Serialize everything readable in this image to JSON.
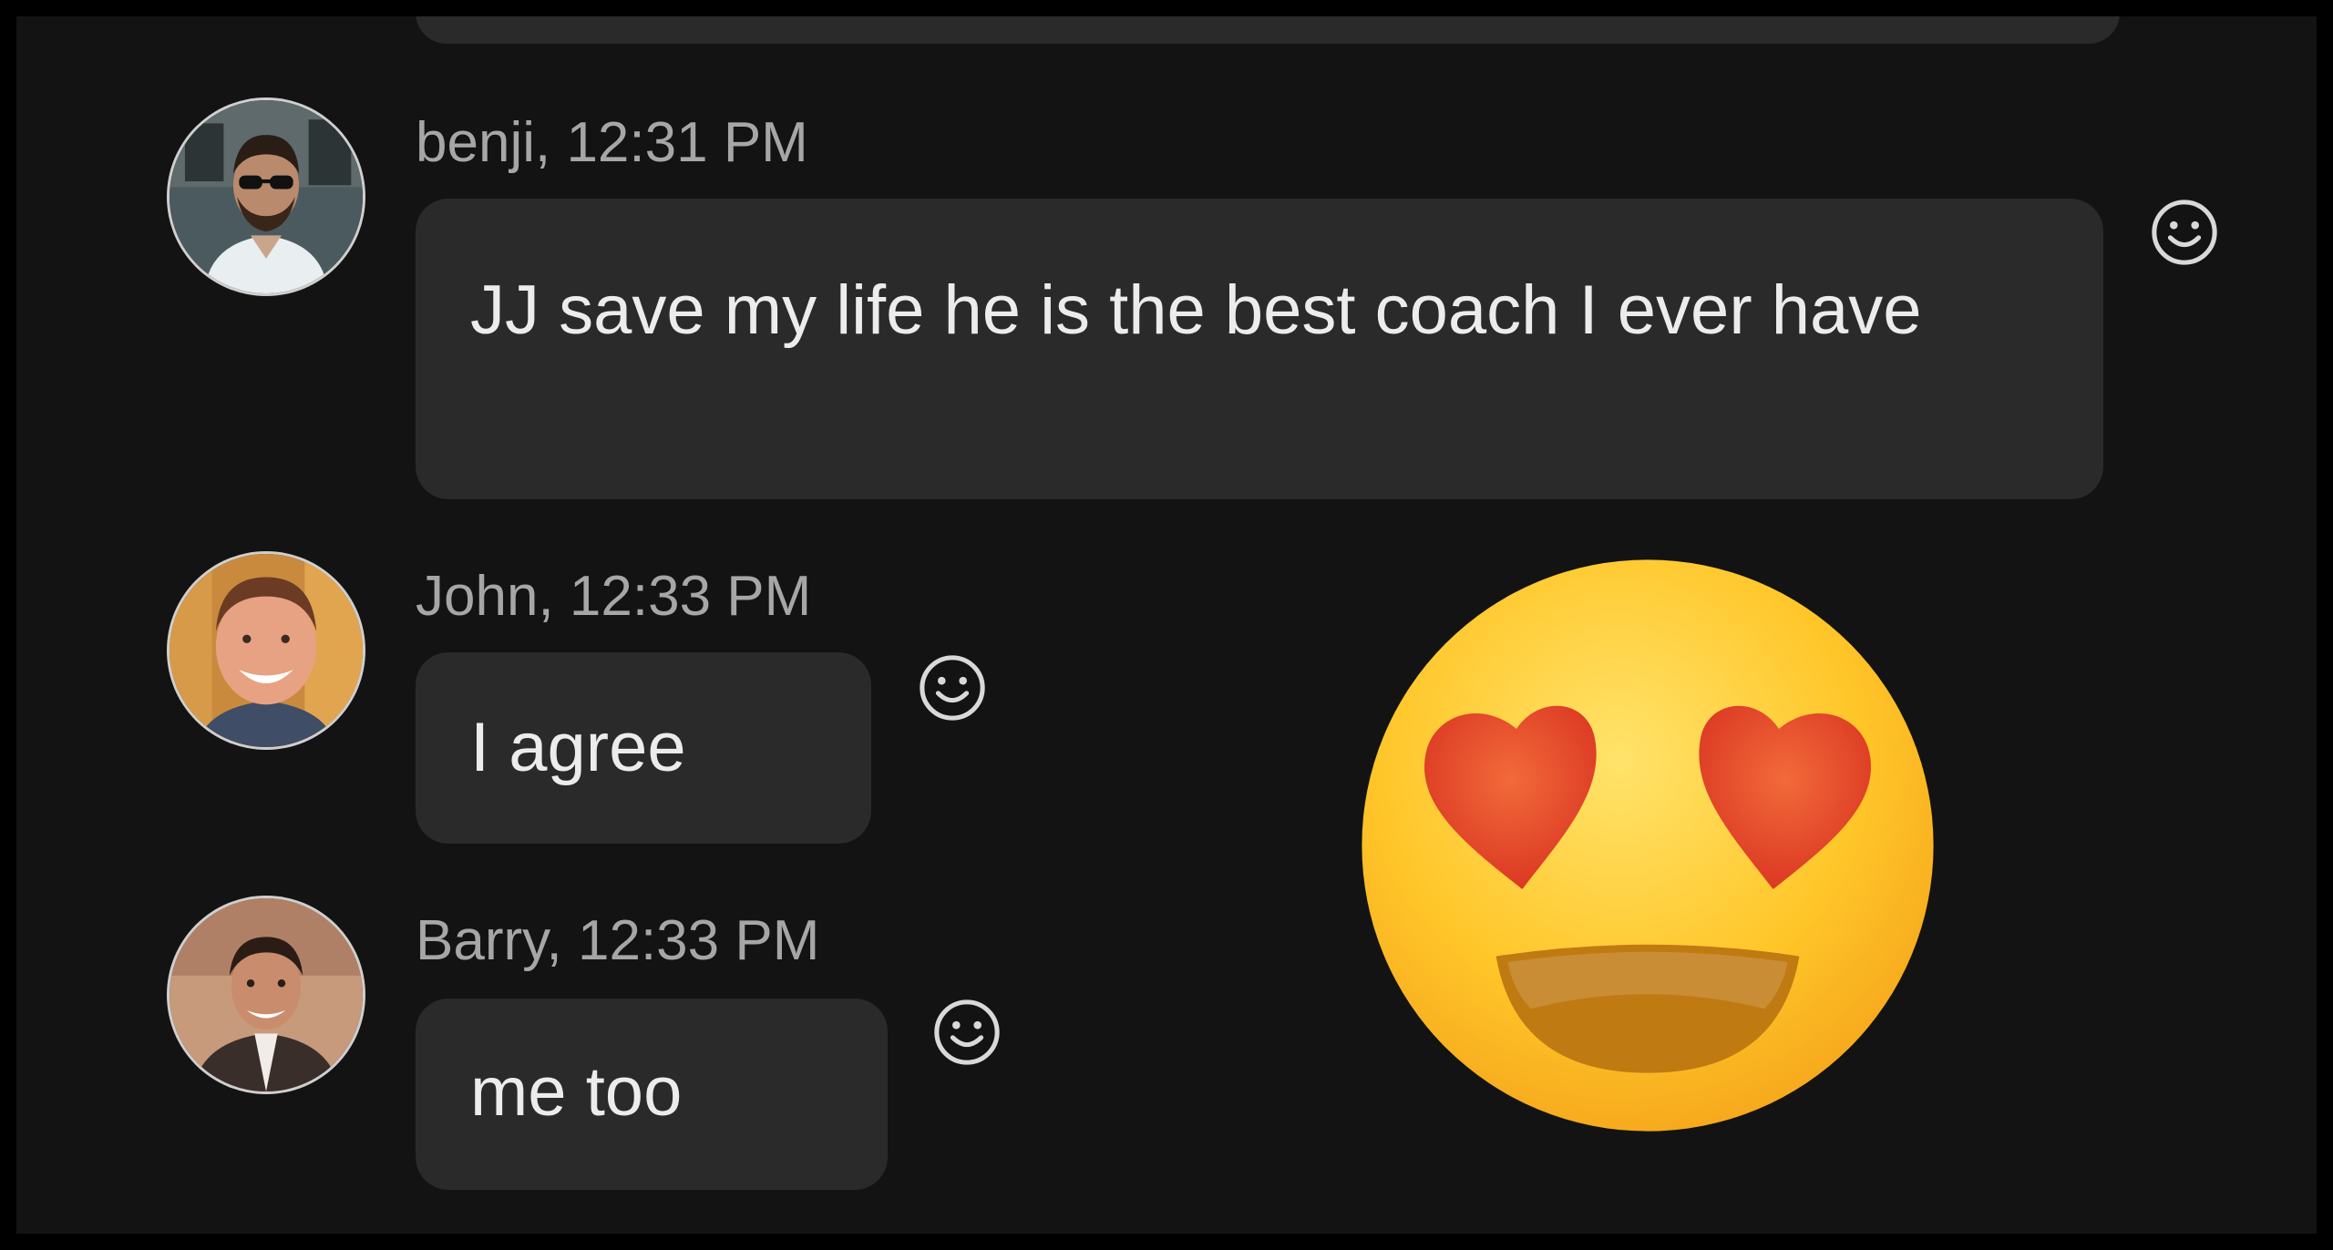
{
  "messages": [
    {
      "author": "benji",
      "time": "12:31 PM",
      "header": "benji, 12:31 PM",
      "text": "JJ save my life he is the best coach I ever have",
      "reaction_icon": "smiley-react-icon"
    },
    {
      "author": "John",
      "time": "12:33 PM",
      "header": "John, 12:33 PM",
      "text": "I agree",
      "reaction_icon": "smiley-react-icon"
    },
    {
      "author": "Barry",
      "time": "12:33 PM",
      "header": "Barry, 12:33 PM",
      "text": "me too",
      "reaction_icon": "smiley-react-icon"
    }
  ],
  "overlay": {
    "icon": "heart-eyes-emoji",
    "colors": {
      "face": "#FFC629",
      "hearts": "#E8452A",
      "mouth": "#C07A12"
    }
  },
  "colors": {
    "background": "#131313",
    "bubble": "#2a2a2a",
    "text": "#ececec",
    "meta": "#a6a6a6"
  }
}
